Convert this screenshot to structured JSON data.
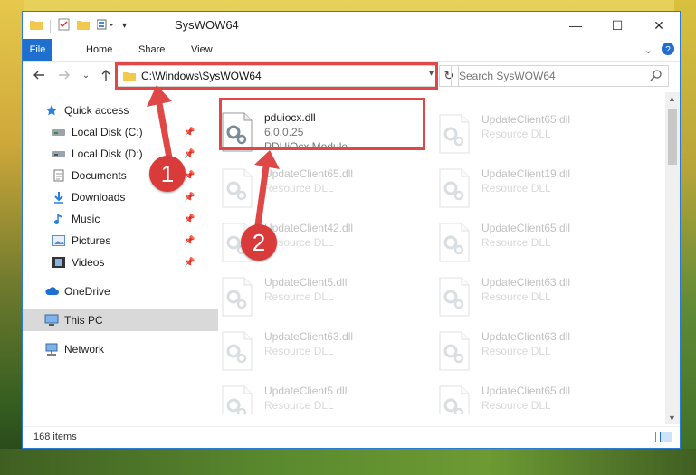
{
  "window": {
    "title": "SysWOW64",
    "minimize_glyph": "—",
    "maximize_glyph": "☐",
    "close_glyph": "✕"
  },
  "ribbon": {
    "tabs": [
      "File",
      "Home",
      "Share",
      "View"
    ]
  },
  "address": {
    "path": "C:\\Windows\\SysWOW64"
  },
  "search": {
    "placeholder": "Search SysWOW64"
  },
  "sidebar": {
    "quick_access": "Quick access",
    "items": [
      {
        "label": "Local Disk (C:)",
        "icon": "drive-icon",
        "pinned": true
      },
      {
        "label": "Local Disk (D:)",
        "icon": "drive-icon",
        "pinned": true
      },
      {
        "label": "Documents",
        "icon": "documents-icon",
        "pinned": true
      },
      {
        "label": "Downloads",
        "icon": "downloads-icon",
        "pinned": true
      },
      {
        "label": "Music",
        "icon": "music-icon",
        "pinned": true
      },
      {
        "label": "Pictures",
        "icon": "pictures-icon",
        "pinned": true
      },
      {
        "label": "Videos",
        "icon": "videos-icon",
        "pinned": true
      }
    ],
    "onedrive": "OneDrive",
    "this_pc": "This PC",
    "network": "Network"
  },
  "files": [
    {
      "name": "pduiocx.dll",
      "line2": "6.0.0.25",
      "line3": "PDUiOcx Module",
      "faded": false
    },
    {
      "name": "UpdateClient65.dll",
      "line2": "Resource DLL",
      "faded": true
    },
    {
      "name": "UpdateClient65.dll",
      "line2": "Resource DLL",
      "faded": true
    },
    {
      "name": "UpdateClient19.dll",
      "line2": "Resource DLL",
      "faded": true
    },
    {
      "name": "UpdateClient42.dll",
      "line2": "Resource DLL",
      "faded": true
    },
    {
      "name": "UpdateClient65.dll",
      "line2": "Resource DLL",
      "faded": true
    },
    {
      "name": "UpdateClient5.dll",
      "line2": "Resource DLL",
      "faded": true
    },
    {
      "name": "UpdateClient63.dll",
      "line2": "Resource DLL",
      "faded": true
    },
    {
      "name": "UpdateClient63.dll",
      "line2": "Resource DLL",
      "faded": true
    },
    {
      "name": "UpdateClient63.dll",
      "line2": "Resource DLL",
      "faded": true
    },
    {
      "name": "UpdateClient5.dll",
      "line2": "Resource DLL",
      "faded": true
    },
    {
      "name": "UpdateClient65.dll",
      "line2": "Resource DLL",
      "faded": true
    }
  ],
  "status": {
    "item_count": "168 items"
  },
  "annotations": {
    "badge1": "1",
    "badge2": "2",
    "color": "#e04848"
  },
  "colors": {
    "accent": "#1f6fd0",
    "selection": "#d9d9d9"
  }
}
